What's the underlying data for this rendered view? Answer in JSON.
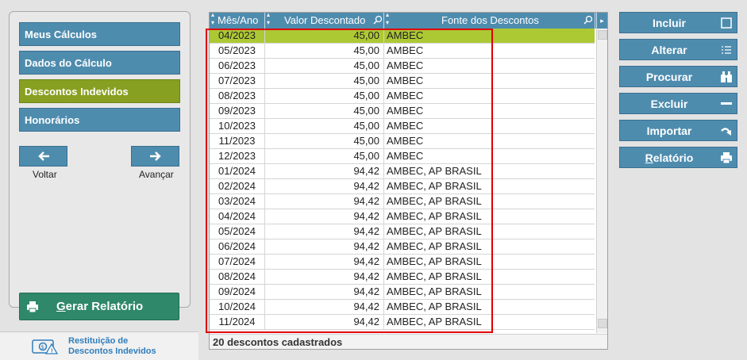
{
  "nav": {
    "items": [
      {
        "label": "Meus Cálculos"
      },
      {
        "label": "Dados do Cálculo"
      },
      {
        "label": "Descontos Indevidos"
      },
      {
        "label": "Honorários"
      }
    ],
    "back_label": "Voltar",
    "next_label": "Avançar",
    "report_label_first": "G",
    "report_label_rest": "erar Relatório"
  },
  "brand": {
    "line1": "Restituição de",
    "line2": "Descontos Indevidos"
  },
  "grid": {
    "columns": [
      "Mês/Ano",
      "Valor Descontado",
      "Fonte dos Descontos"
    ],
    "scroll_arrow": "▸",
    "rows": [
      {
        "mes": "04/2023",
        "valor": "45,00",
        "fonte": "AMBEC"
      },
      {
        "mes": "05/2023",
        "valor": "45,00",
        "fonte": "AMBEC"
      },
      {
        "mes": "06/2023",
        "valor": "45,00",
        "fonte": "AMBEC"
      },
      {
        "mes": "07/2023",
        "valor": "45,00",
        "fonte": "AMBEC"
      },
      {
        "mes": "08/2023",
        "valor": "45,00",
        "fonte": "AMBEC"
      },
      {
        "mes": "09/2023",
        "valor": "45,00",
        "fonte": "AMBEC"
      },
      {
        "mes": "10/2023",
        "valor": "45,00",
        "fonte": "AMBEC"
      },
      {
        "mes": "11/2023",
        "valor": "45,00",
        "fonte": "AMBEC"
      },
      {
        "mes": "12/2023",
        "valor": "45,00",
        "fonte": "AMBEC"
      },
      {
        "mes": "01/2024",
        "valor": "94,42",
        "fonte": "AMBEC, AP BRASIL"
      },
      {
        "mes": "02/2024",
        "valor": "94,42",
        "fonte": "AMBEC, AP BRASIL"
      },
      {
        "mes": "03/2024",
        "valor": "94,42",
        "fonte": "AMBEC, AP BRASIL"
      },
      {
        "mes": "04/2024",
        "valor": "94,42",
        "fonte": "AMBEC, AP BRASIL"
      },
      {
        "mes": "05/2024",
        "valor": "94,42",
        "fonte": "AMBEC, AP BRASIL"
      },
      {
        "mes": "06/2024",
        "valor": "94,42",
        "fonte": "AMBEC, AP BRASIL"
      },
      {
        "mes": "07/2024",
        "valor": "94,42",
        "fonte": "AMBEC, AP BRASIL"
      },
      {
        "mes": "08/2024",
        "valor": "94,42",
        "fonte": "AMBEC, AP BRASIL"
      },
      {
        "mes": "09/2024",
        "valor": "94,42",
        "fonte": "AMBEC, AP BRASIL"
      },
      {
        "mes": "10/2024",
        "valor": "94,42",
        "fonte": "AMBEC, AP BRASIL"
      },
      {
        "mes": "11/2024",
        "valor": "94,42",
        "fonte": "AMBEC, AP BRASIL"
      }
    ],
    "footer": "20 descontos cadastrados"
  },
  "actions": {
    "incluir": "Incluir",
    "alterar": "Alterar",
    "procurar": "Procurar",
    "excluir": "Excluir",
    "importar": "Importar",
    "relatorio_first": "R",
    "relatorio_rest": "elatório"
  },
  "colors": {
    "primary": "#4e8cae",
    "active": "#88a022",
    "selected_row": "#acc934",
    "report_button": "#2f8869",
    "highlight": "#e00000"
  },
  "icons": {
    "back": "arrow-left-icon",
    "next": "arrow-right-icon",
    "report": "printer-icon",
    "incluir": "square-icon",
    "alterar": "list-icon",
    "procurar": "binoculars-icon",
    "excluir": "minus-icon",
    "importar": "curved-arrow-icon",
    "relatorio": "printer-icon"
  }
}
